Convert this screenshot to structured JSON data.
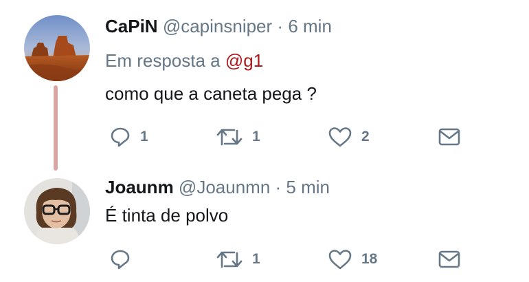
{
  "tweets": [
    {
      "name": "CaPiN",
      "handle": "@capinsniper",
      "separator": "·",
      "time": "6 min",
      "reply_prefix": "Em resposta a",
      "reply_mention": "@g1",
      "text": "como que a caneta pega ?",
      "avatar": "desert-landscape-avatar",
      "actions": {
        "reply_count": "1",
        "retweet_count": "1",
        "like_count": "2",
        "message_count": ""
      }
    },
    {
      "name": "Joaunm",
      "handle": "@Joaunmn",
      "separator": "·",
      "time": "5 min",
      "text": "É tinta de polvo",
      "avatar": "person-with-glasses-avatar",
      "actions": {
        "reply_count": "",
        "retweet_count": "1",
        "like_count": "18",
        "message_count": ""
      }
    }
  ],
  "colors": {
    "text": "#14171a",
    "muted": "#657786",
    "mention": "#b0181e",
    "thread_line": "#d8a7a4"
  },
  "icons": [
    "reply-icon",
    "retweet-icon",
    "like-icon",
    "direct-message-icon"
  ]
}
